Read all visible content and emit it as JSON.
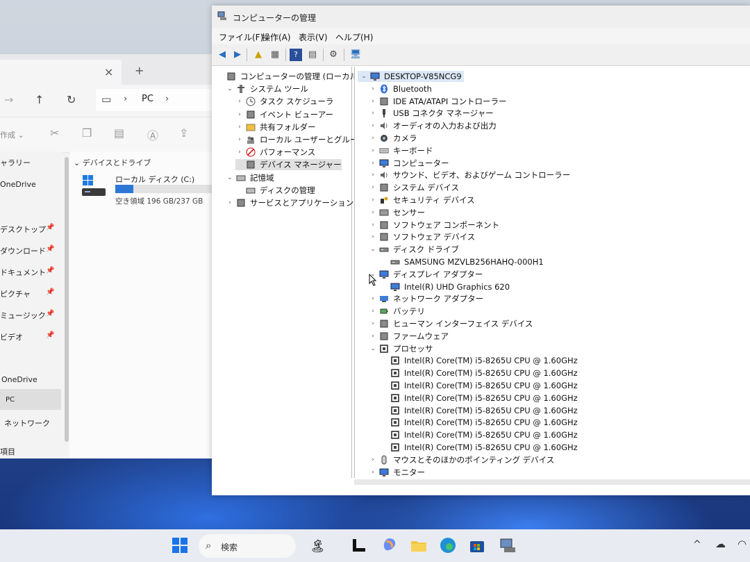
{
  "explorer": {
    "tab_close": "×",
    "tab_new": "+",
    "address_sep1": "›",
    "address_pc": "PC",
    "address_sep2": "›",
    "new_button": "作成 ⌄",
    "sidebar": [
      {
        "label": "ャラリー",
        "pinned": false
      },
      {
        "label": "OneDrive",
        "pinned": false
      },
      {
        "label": "デスクトップ",
        "pinned": true
      },
      {
        "label": "ダウンロード",
        "pinned": true
      },
      {
        "label": "ドキュメント",
        "pinned": true
      },
      {
        "label": "ピクチャ",
        "pinned": true
      },
      {
        "label": "ミュージック",
        "pinned": true
      },
      {
        "label": "ビデオ",
        "pinned": true
      },
      {
        "label": "OneDrive",
        "pinned": false
      },
      {
        "label": "PC",
        "pinned": false
      },
      {
        "label": "ネットワーク",
        "pinned": false
      },
      {
        "label": "項目",
        "pinned": false
      }
    ],
    "section_header": "デバイスとドライブ",
    "drive": {
      "name": "ローカル ディスク (C:)",
      "free_text": "空き領域 196 GB/237 GB",
      "used_fraction": 0.17
    }
  },
  "mgmt": {
    "title": "コンピューターの管理",
    "menu": [
      "ファイル(F)",
      "操作(A)",
      "表示(V)",
      "ヘルプ(H)"
    ],
    "left_tree": [
      {
        "label": "コンピューターの管理 (ローカル)",
        "chev": "",
        "level": 0,
        "icon": "computer-mgmt-icon"
      },
      {
        "label": "システム ツール",
        "chev": "⌄",
        "level": 1,
        "icon": "tools-icon"
      },
      {
        "label": "タスク スケジューラ",
        "chev": "›",
        "level": 2,
        "icon": "clock-icon"
      },
      {
        "label": "イベント ビューアー",
        "chev": "›",
        "level": 2,
        "icon": "event-viewer-icon"
      },
      {
        "label": "共有フォルダー",
        "chev": "›",
        "level": 2,
        "icon": "shared-folder-icon"
      },
      {
        "label": "ローカル ユーザーとグループ",
        "chev": "›",
        "level": 2,
        "icon": "users-icon"
      },
      {
        "label": "パフォーマンス",
        "chev": "›",
        "level": 2,
        "icon": "performance-icon"
      },
      {
        "label": "デバイス マネージャー",
        "chev": "",
        "level": 2,
        "icon": "device-manager-icon",
        "selected": true
      },
      {
        "label": "記憶域",
        "chev": "⌄",
        "level": 1,
        "icon": "storage-icon"
      },
      {
        "label": "ディスクの管理",
        "chev": "",
        "level": 2,
        "icon": "disk-management-icon"
      },
      {
        "label": "サービスとアプリケーション",
        "chev": "›",
        "level": 1,
        "icon": "services-icon"
      }
    ],
    "device_tree": [
      {
        "label": "DESKTOP-V85NCG9",
        "chev": "⌄",
        "level": 0,
        "icon": "computer-icon",
        "highlight": true
      },
      {
        "label": "Bluetooth",
        "chev": "›",
        "level": 1,
        "icon": "bluetooth-icon"
      },
      {
        "label": "IDE ATA/ATAPI コントローラー",
        "chev": "›",
        "level": 1,
        "icon": "ide-controller-icon"
      },
      {
        "label": "USB コネクタ マネージャー",
        "chev": "›",
        "level": 1,
        "icon": "usb-icon"
      },
      {
        "label": "オーディオの入力および出力",
        "chev": "›",
        "level": 1,
        "icon": "speaker-icon"
      },
      {
        "label": "カメラ",
        "chev": "›",
        "level": 1,
        "icon": "camera-icon"
      },
      {
        "label": "キーボード",
        "chev": "›",
        "level": 1,
        "icon": "keyboard-icon"
      },
      {
        "label": "コンピューター",
        "chev": "›",
        "level": 1,
        "icon": "monitor-icon"
      },
      {
        "label": "サウンド、ビデオ、およびゲーム コントローラー",
        "chev": "›",
        "level": 1,
        "icon": "sound-icon"
      },
      {
        "label": "システム デバイス",
        "chev": "›",
        "level": 1,
        "icon": "system-device-icon"
      },
      {
        "label": "セキュリティ デバイス",
        "chev": "›",
        "level": 1,
        "icon": "security-device-icon"
      },
      {
        "label": "センサー",
        "chev": "›",
        "level": 1,
        "icon": "sensor-icon"
      },
      {
        "label": "ソフトウェア コンポーネント",
        "chev": "›",
        "level": 1,
        "icon": "software-component-icon"
      },
      {
        "label": "ソフトウェア デバイス",
        "chev": "›",
        "level": 1,
        "icon": "software-device-icon"
      },
      {
        "label": "ディスク ドライブ",
        "chev": "⌄",
        "level": 1,
        "icon": "disk-drive-icon"
      },
      {
        "label": "SAMSUNG MZVLB256HAHQ-000H1",
        "chev": "",
        "level": 2,
        "icon": "disk-drive-icon"
      },
      {
        "label": "ディスプレイ アダプター",
        "chev": "⌄",
        "level": 1,
        "icon": "display-adapter-icon"
      },
      {
        "label": "Intel(R) UHD Graphics 620",
        "chev": "",
        "level": 2,
        "icon": "display-adapter-icon"
      },
      {
        "label": "ネットワーク アダプター",
        "chev": "›",
        "level": 1,
        "icon": "network-adapter-icon"
      },
      {
        "label": "バッテリ",
        "chev": "›",
        "level": 1,
        "icon": "battery-icon"
      },
      {
        "label": "ヒューマン インターフェイス デバイス",
        "chev": "›",
        "level": 1,
        "icon": "hid-icon"
      },
      {
        "label": "ファームウェア",
        "chev": "›",
        "level": 1,
        "icon": "firmware-icon"
      },
      {
        "label": "プロセッサ",
        "chev": "⌄",
        "level": 1,
        "icon": "processor-icon"
      },
      {
        "label": "Intel(R) Core(TM) i5-8265U CPU @ 1.60GHz",
        "chev": "",
        "level": 2,
        "icon": "processor-icon"
      },
      {
        "label": "Intel(R) Core(TM) i5-8265U CPU @ 1.60GHz",
        "chev": "",
        "level": 2,
        "icon": "processor-icon"
      },
      {
        "label": "Intel(R) Core(TM) i5-8265U CPU @ 1.60GHz",
        "chev": "",
        "level": 2,
        "icon": "processor-icon"
      },
      {
        "label": "Intel(R) Core(TM) i5-8265U CPU @ 1.60GHz",
        "chev": "",
        "level": 2,
        "icon": "processor-icon"
      },
      {
        "label": "Intel(R) Core(TM) i5-8265U CPU @ 1.60GHz",
        "chev": "",
        "level": 2,
        "icon": "processor-icon"
      },
      {
        "label": "Intel(R) Core(TM) i5-8265U CPU @ 1.60GHz",
        "chev": "",
        "level": 2,
        "icon": "processor-icon"
      },
      {
        "label": "Intel(R) Core(TM) i5-8265U CPU @ 1.60GHz",
        "chev": "",
        "level": 2,
        "icon": "processor-icon"
      },
      {
        "label": "Intel(R) Core(TM) i5-8265U CPU @ 1.60GHz",
        "chev": "",
        "level": 2,
        "icon": "processor-icon"
      },
      {
        "label": "マウスとそのほかのポインティング デバイス",
        "chev": "›",
        "level": 1,
        "icon": "mouse-icon"
      },
      {
        "label": "モニター",
        "chev": "›",
        "level": 1,
        "icon": "monitor-icon"
      }
    ]
  },
  "taskbar": {
    "search_label": "検索",
    "icons": [
      "start-icon",
      "widgets-icon",
      "task-view-icon",
      "copilot-icon",
      "file-explorer-icon",
      "edge-icon",
      "store-icon",
      "computer-management-icon"
    ]
  },
  "colors": {
    "accent": "#2d78d6",
    "highlight_row": "#e0e0e0",
    "selected_node_bg": "#dce8f7"
  }
}
